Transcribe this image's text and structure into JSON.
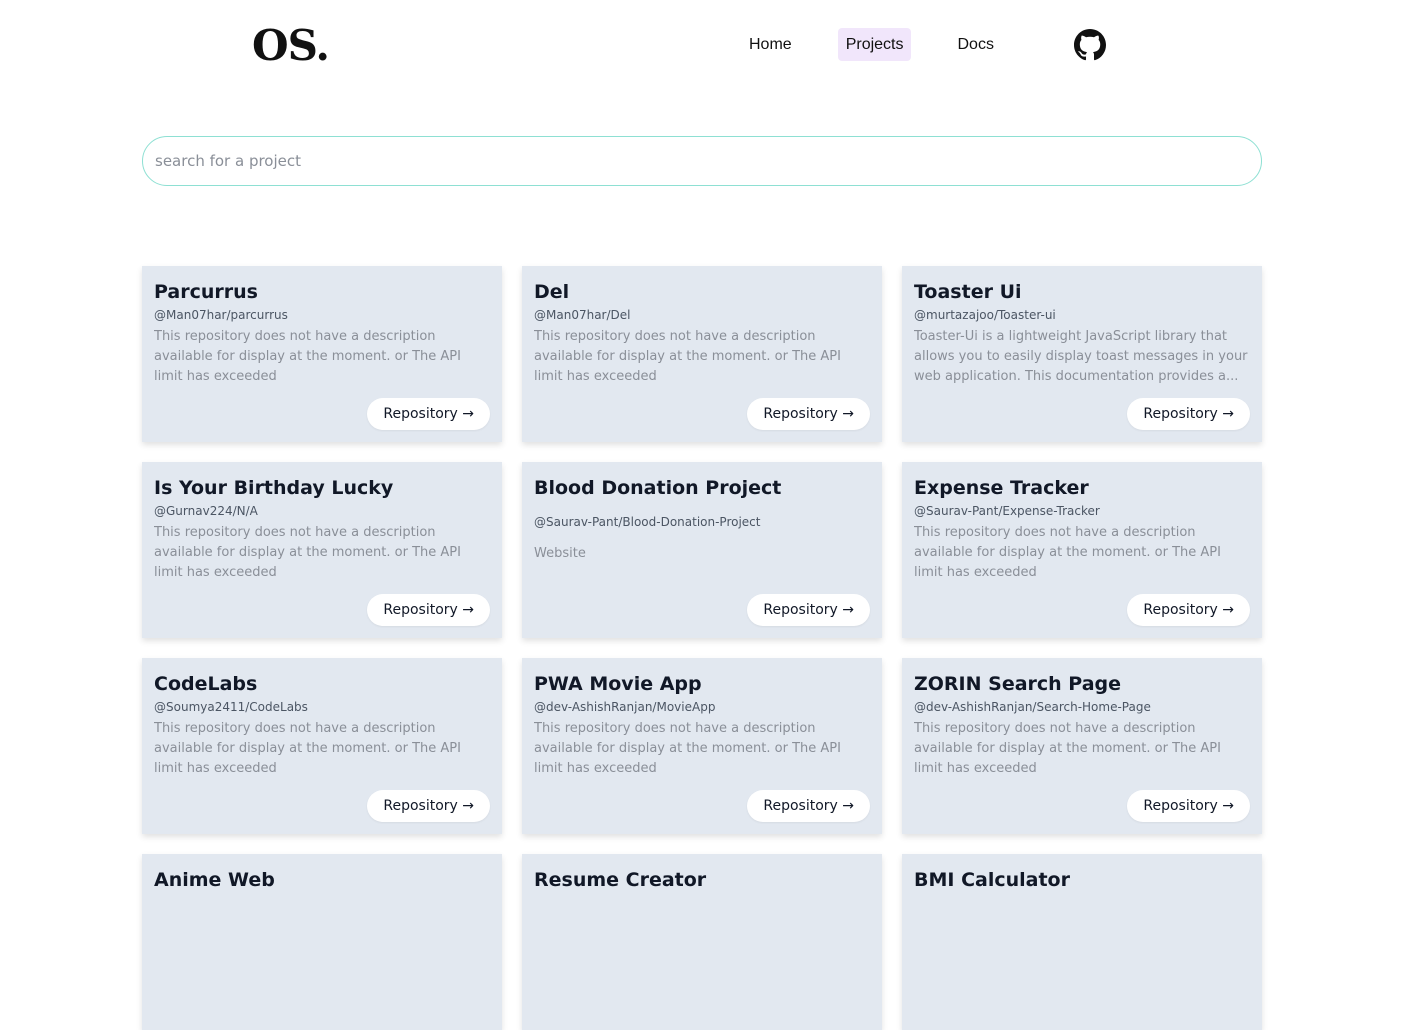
{
  "brand": {
    "logo": "OS."
  },
  "nav": {
    "links": [
      {
        "label": "Home",
        "active": false
      },
      {
        "label": "Projects",
        "active": true
      },
      {
        "label": "Docs",
        "active": false
      }
    ],
    "github_icon": "github-icon"
  },
  "search": {
    "placeholder": "search for a project",
    "value": ""
  },
  "cards": [
    {
      "title": "Parcurrus",
      "handle": "@Man07har/parcurrus",
      "desc": "This repository does not have a description available for display at the moment. or The API limit has exceeded",
      "button": "Repository →"
    },
    {
      "title": "Del",
      "handle": "@Man07har/Del",
      "desc": "This repository does not have a description available for display at the moment. or The API limit has exceeded",
      "button": "Repository →"
    },
    {
      "title": "Toaster Ui",
      "handle": "@murtazajoo/Toaster-ui",
      "desc": "Toaster-Ui is a lightweight JavaScript library that allows you to easily display toast messages in your web application. This documentation provides a...",
      "button": "Repository →"
    },
    {
      "title": "Is Your Birthday Lucky",
      "handle": "@Gurnav224/N/A",
      "desc": "This repository does not have a description available for display at the moment. or The API limit has exceeded",
      "button": "Repository →"
    },
    {
      "title": "Blood Donation Project",
      "handle": "@Saurav-Pant/Blood-Donation-Project",
      "desc": "Website",
      "button": "Repository →"
    },
    {
      "title": "Expense Tracker",
      "handle": "@Saurav-Pant/Expense-Tracker",
      "desc": "This repository does not have a description available for display at the moment. or The API limit has exceeded",
      "button": "Repository →"
    },
    {
      "title": "CodeLabs",
      "handle": "@Soumya2411/CodeLabs",
      "desc": "This repository does not have a description available for display at the moment. or The API limit has exceeded",
      "button": "Repository →"
    },
    {
      "title": "PWA Movie App",
      "handle": "@dev-AshishRanjan/MovieApp",
      "desc": "This repository does not have a description available for display at the moment. or The API limit has exceeded",
      "button": "Repository →"
    },
    {
      "title": "ZORIN Search Page",
      "handle": "@dev-AshishRanjan/Search-Home-Page",
      "desc": "This repository does not have a description available for display at the moment. or The API limit has exceeded",
      "button": "Repository →"
    },
    {
      "title": "Anime Web",
      "handle": "",
      "desc": "",
      "button": ""
    },
    {
      "title": "Resume Creator",
      "handle": "",
      "desc": "",
      "button": ""
    },
    {
      "title": "BMI Calculator",
      "handle": "",
      "desc": "",
      "button": ""
    }
  ]
}
